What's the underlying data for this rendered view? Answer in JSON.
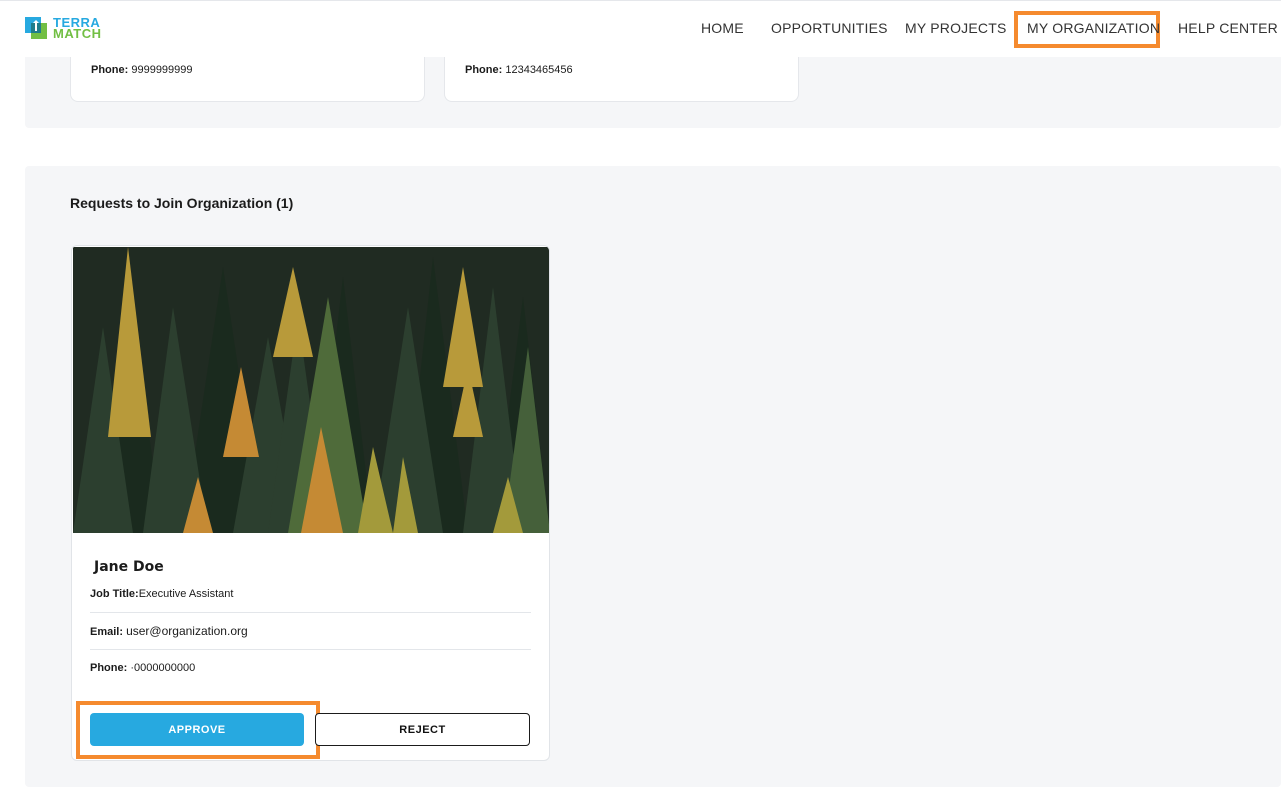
{
  "brand": {
    "line1": "TERRA",
    "line2": "MATCH",
    "color_blue": "#27a9e0",
    "color_green": "#72bf44"
  },
  "nav": {
    "home": "HOME",
    "opportunities": "OPPORTUNITIES",
    "my_projects": "MY PROJECTS",
    "my_organization": "MY ORGANIZATION",
    "help_center": "HELP CENTER"
  },
  "contacts": [
    {
      "phone_label": "Phone:",
      "phone": "9999999999"
    },
    {
      "phone_label": "Phone:",
      "phone": "12343465456"
    }
  ],
  "requests": {
    "title": "Requests to Join Organization (1)",
    "member": {
      "name": "Jane Doe",
      "job_label": "Job Title:",
      "job": "Executive Assistant",
      "email_label": "Email:",
      "email": "user@organization.org",
      "phone_label": "Phone:",
      "phone": "·0000000000"
    },
    "approve_label": "APPROVE",
    "reject_label": "REJECT"
  },
  "colors": {
    "highlight": "#f58a2e",
    "approve": "#27a9e0",
    "panel": "#f5f6f8"
  }
}
